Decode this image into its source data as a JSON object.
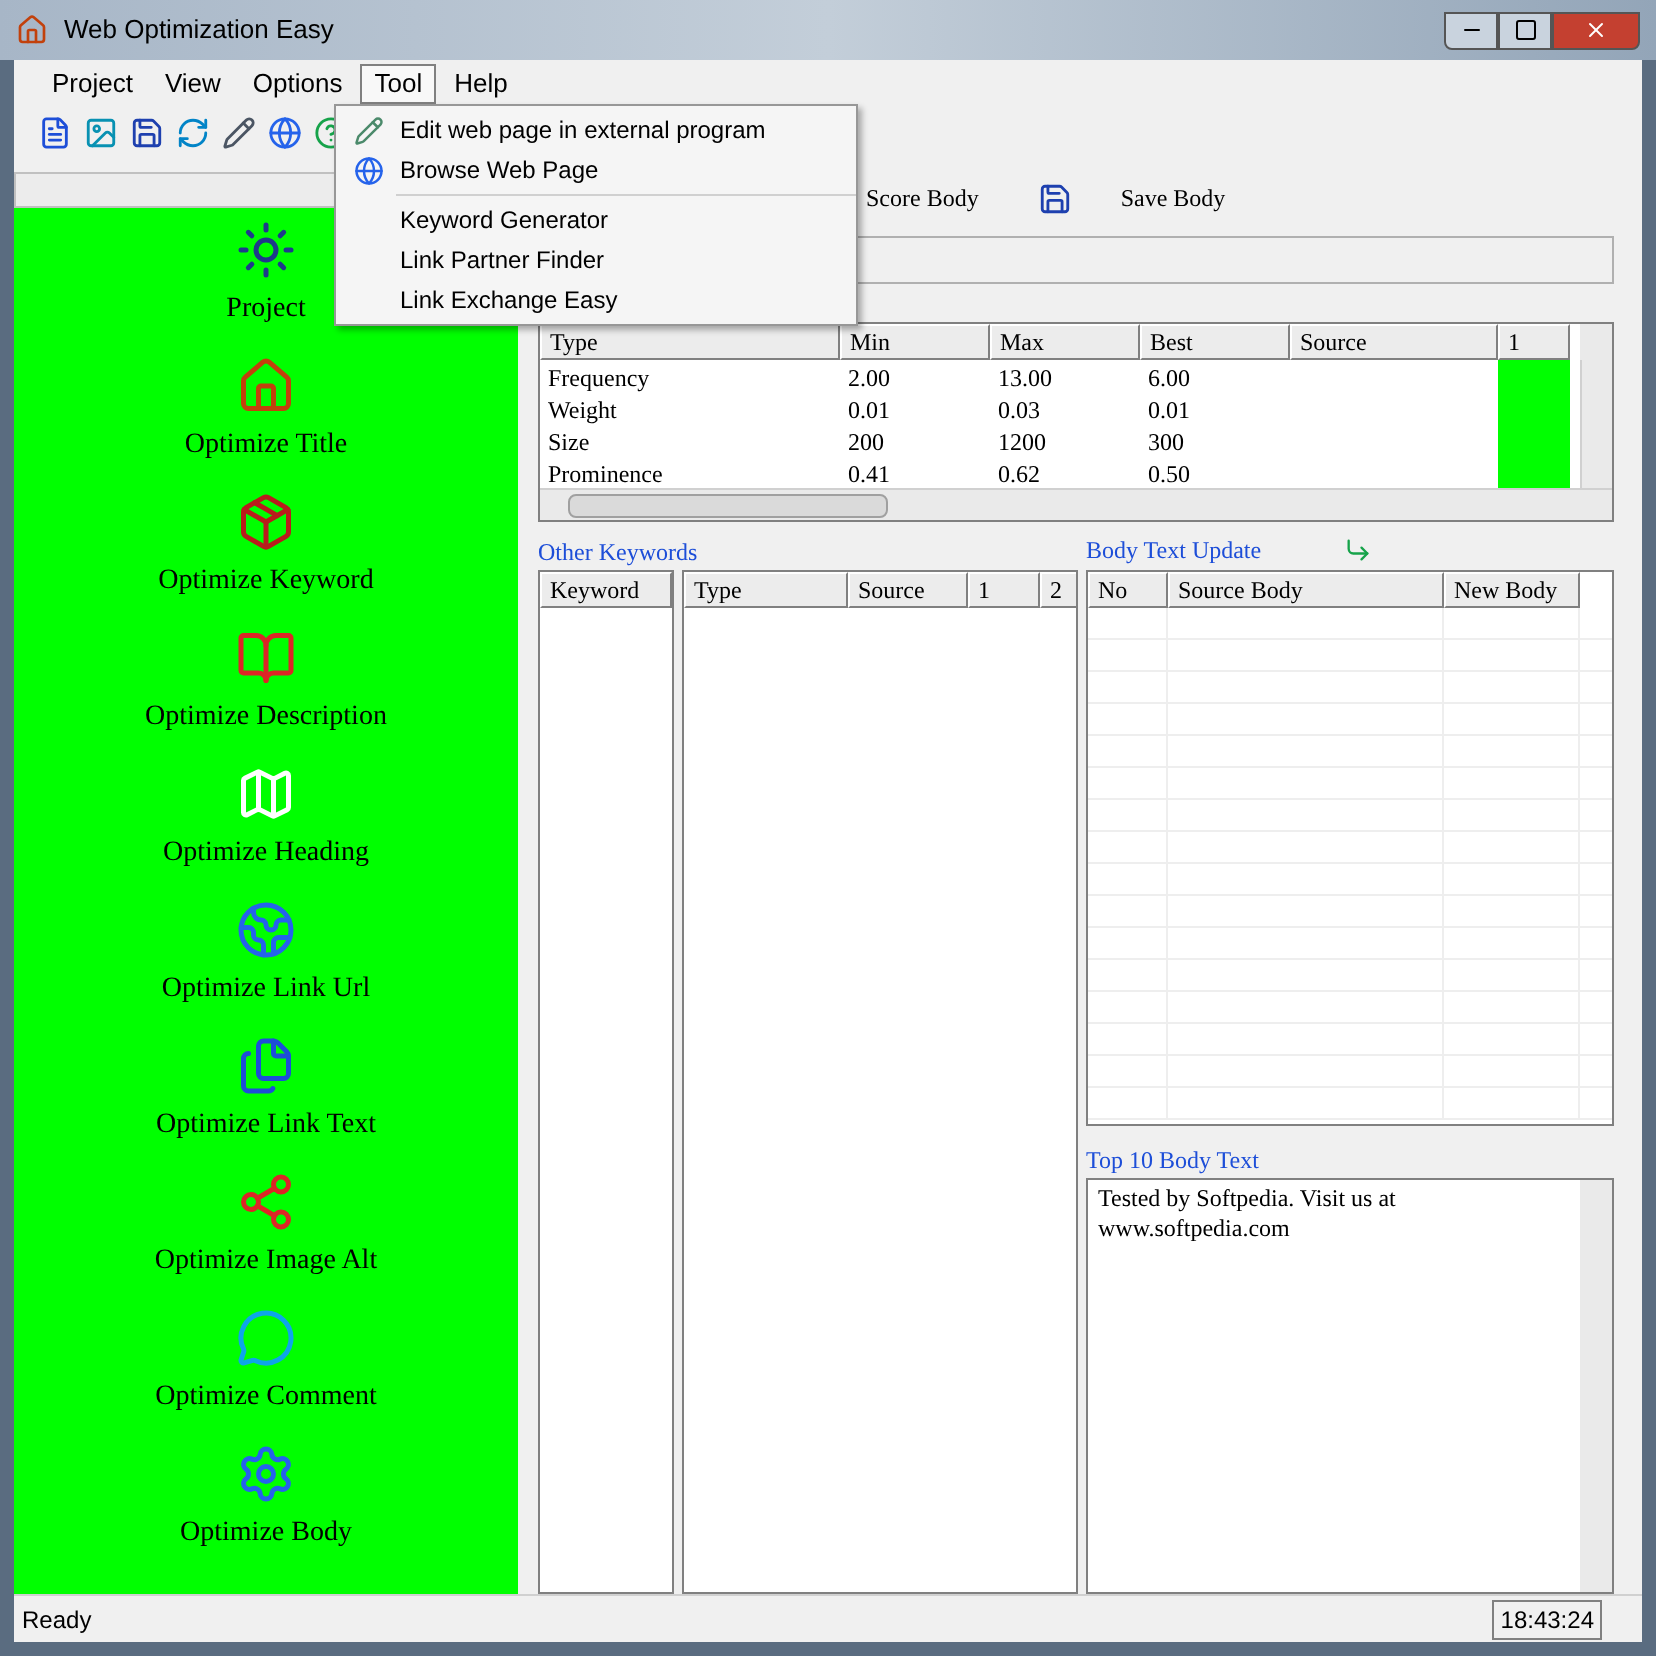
{
  "window": {
    "title": "Web Optimization Easy"
  },
  "menu": [
    {
      "label": "Project",
      "selected": false
    },
    {
      "label": "View",
      "selected": false
    },
    {
      "label": "Options",
      "selected": false
    },
    {
      "label": "Tool",
      "selected": true
    },
    {
      "label": "Help",
      "selected": false
    }
  ],
  "dropdown": [
    {
      "label": "Edit web page in external program",
      "kind": "pencil"
    },
    {
      "label": "Browse Web Page",
      "kind": "globe"
    },
    {
      "label": "Keyword Generator",
      "kind": "plain",
      "separator_before": true
    },
    {
      "label": "Link Partner Finder",
      "kind": "plain"
    },
    {
      "label": "Link Exchange Easy",
      "kind": "plain"
    }
  ],
  "sidebar": {
    "items": [
      {
        "label": "Project"
      },
      {
        "label": "Optimize Title"
      },
      {
        "label": "Optimize Keyword"
      },
      {
        "label": "Optimize Description"
      },
      {
        "label": "Optimize Heading"
      },
      {
        "label": "Optimize Link Url"
      },
      {
        "label": "Optimize Link Text"
      },
      {
        "label": "Optimize Image Alt"
      },
      {
        "label": "Optimize Comment"
      },
      {
        "label": "Optimize Body"
      }
    ]
  },
  "body_toolbar": [
    "Score Body",
    "Save Body"
  ],
  "metrics_table": {
    "columns": [
      "Type",
      "Min",
      "Max",
      "Best",
      "Source",
      "1"
    ],
    "rows": [
      {
        "cells": [
          "Frequency",
          "2.00",
          "13.00",
          "6.00"
        ],
        "color": "#00ff00"
      },
      {
        "cells": [
          "Weight",
          "0.01",
          "0.03",
          "0.01"
        ],
        "color": "#00ff00"
      },
      {
        "cells": [
          "Size",
          "200",
          "1200",
          "300"
        ],
        "color": "#00ff00"
      },
      {
        "cells": [
          "Prominence",
          "0.41",
          "0.62",
          "0.50"
        ],
        "color": "#00ff00"
      }
    ]
  },
  "other_keywords": {
    "title": "Other Keywords",
    "keyword_columns": [
      "Keyword"
    ],
    "columns": [
      "Type",
      "Source",
      "1",
      "2"
    ]
  },
  "body_text_update": {
    "title": "Body Text Update",
    "columns": [
      "No",
      "Source Body",
      "New Body"
    ]
  },
  "top10": {
    "title": "Top 10 Body Text",
    "text": "Tested by Softpedia. Visit us at www.softpedia.com"
  },
  "status_bar": {
    "text": "Ready",
    "time": "18:43:24"
  }
}
